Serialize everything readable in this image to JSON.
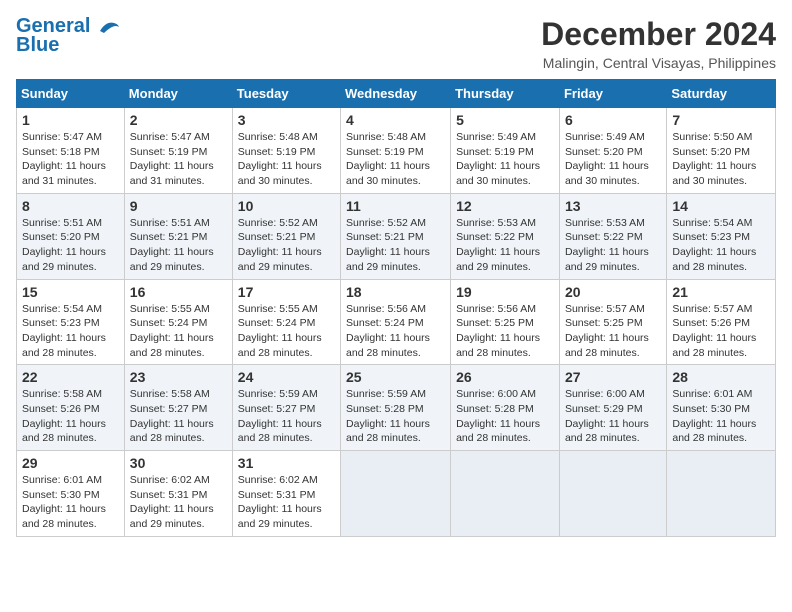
{
  "header": {
    "logo_line1": "General",
    "logo_line2": "Blue",
    "month_title": "December 2024",
    "location": "Malingin, Central Visayas, Philippines"
  },
  "weekdays": [
    "Sunday",
    "Monday",
    "Tuesday",
    "Wednesday",
    "Thursday",
    "Friday",
    "Saturday"
  ],
  "weeks": [
    [
      {
        "day": "1",
        "sunrise": "Sunrise: 5:47 AM",
        "sunset": "Sunset: 5:18 PM",
        "daylight": "Daylight: 11 hours and 31 minutes."
      },
      {
        "day": "2",
        "sunrise": "Sunrise: 5:47 AM",
        "sunset": "Sunset: 5:19 PM",
        "daylight": "Daylight: 11 hours and 31 minutes."
      },
      {
        "day": "3",
        "sunrise": "Sunrise: 5:48 AM",
        "sunset": "Sunset: 5:19 PM",
        "daylight": "Daylight: 11 hours and 30 minutes."
      },
      {
        "day": "4",
        "sunrise": "Sunrise: 5:48 AM",
        "sunset": "Sunset: 5:19 PM",
        "daylight": "Daylight: 11 hours and 30 minutes."
      },
      {
        "day": "5",
        "sunrise": "Sunrise: 5:49 AM",
        "sunset": "Sunset: 5:19 PM",
        "daylight": "Daylight: 11 hours and 30 minutes."
      },
      {
        "day": "6",
        "sunrise": "Sunrise: 5:49 AM",
        "sunset": "Sunset: 5:20 PM",
        "daylight": "Daylight: 11 hours and 30 minutes."
      },
      {
        "day": "7",
        "sunrise": "Sunrise: 5:50 AM",
        "sunset": "Sunset: 5:20 PM",
        "daylight": "Daylight: 11 hours and 30 minutes."
      }
    ],
    [
      {
        "day": "8",
        "sunrise": "Sunrise: 5:51 AM",
        "sunset": "Sunset: 5:20 PM",
        "daylight": "Daylight: 11 hours and 29 minutes."
      },
      {
        "day": "9",
        "sunrise": "Sunrise: 5:51 AM",
        "sunset": "Sunset: 5:21 PM",
        "daylight": "Daylight: 11 hours and 29 minutes."
      },
      {
        "day": "10",
        "sunrise": "Sunrise: 5:52 AM",
        "sunset": "Sunset: 5:21 PM",
        "daylight": "Daylight: 11 hours and 29 minutes."
      },
      {
        "day": "11",
        "sunrise": "Sunrise: 5:52 AM",
        "sunset": "Sunset: 5:21 PM",
        "daylight": "Daylight: 11 hours and 29 minutes."
      },
      {
        "day": "12",
        "sunrise": "Sunrise: 5:53 AM",
        "sunset": "Sunset: 5:22 PM",
        "daylight": "Daylight: 11 hours and 29 minutes."
      },
      {
        "day": "13",
        "sunrise": "Sunrise: 5:53 AM",
        "sunset": "Sunset: 5:22 PM",
        "daylight": "Daylight: 11 hours and 29 minutes."
      },
      {
        "day": "14",
        "sunrise": "Sunrise: 5:54 AM",
        "sunset": "Sunset: 5:23 PM",
        "daylight": "Daylight: 11 hours and 28 minutes."
      }
    ],
    [
      {
        "day": "15",
        "sunrise": "Sunrise: 5:54 AM",
        "sunset": "Sunset: 5:23 PM",
        "daylight": "Daylight: 11 hours and 28 minutes."
      },
      {
        "day": "16",
        "sunrise": "Sunrise: 5:55 AM",
        "sunset": "Sunset: 5:24 PM",
        "daylight": "Daylight: 11 hours and 28 minutes."
      },
      {
        "day": "17",
        "sunrise": "Sunrise: 5:55 AM",
        "sunset": "Sunset: 5:24 PM",
        "daylight": "Daylight: 11 hours and 28 minutes."
      },
      {
        "day": "18",
        "sunrise": "Sunrise: 5:56 AM",
        "sunset": "Sunset: 5:24 PM",
        "daylight": "Daylight: 11 hours and 28 minutes."
      },
      {
        "day": "19",
        "sunrise": "Sunrise: 5:56 AM",
        "sunset": "Sunset: 5:25 PM",
        "daylight": "Daylight: 11 hours and 28 minutes."
      },
      {
        "day": "20",
        "sunrise": "Sunrise: 5:57 AM",
        "sunset": "Sunset: 5:25 PM",
        "daylight": "Daylight: 11 hours and 28 minutes."
      },
      {
        "day": "21",
        "sunrise": "Sunrise: 5:57 AM",
        "sunset": "Sunset: 5:26 PM",
        "daylight": "Daylight: 11 hours and 28 minutes."
      }
    ],
    [
      {
        "day": "22",
        "sunrise": "Sunrise: 5:58 AM",
        "sunset": "Sunset: 5:26 PM",
        "daylight": "Daylight: 11 hours and 28 minutes."
      },
      {
        "day": "23",
        "sunrise": "Sunrise: 5:58 AM",
        "sunset": "Sunset: 5:27 PM",
        "daylight": "Daylight: 11 hours and 28 minutes."
      },
      {
        "day": "24",
        "sunrise": "Sunrise: 5:59 AM",
        "sunset": "Sunset: 5:27 PM",
        "daylight": "Daylight: 11 hours and 28 minutes."
      },
      {
        "day": "25",
        "sunrise": "Sunrise: 5:59 AM",
        "sunset": "Sunset: 5:28 PM",
        "daylight": "Daylight: 11 hours and 28 minutes."
      },
      {
        "day": "26",
        "sunrise": "Sunrise: 6:00 AM",
        "sunset": "Sunset: 5:28 PM",
        "daylight": "Daylight: 11 hours and 28 minutes."
      },
      {
        "day": "27",
        "sunrise": "Sunrise: 6:00 AM",
        "sunset": "Sunset: 5:29 PM",
        "daylight": "Daylight: 11 hours and 28 minutes."
      },
      {
        "day": "28",
        "sunrise": "Sunrise: 6:01 AM",
        "sunset": "Sunset: 5:30 PM",
        "daylight": "Daylight: 11 hours and 28 minutes."
      }
    ],
    [
      {
        "day": "29",
        "sunrise": "Sunrise: 6:01 AM",
        "sunset": "Sunset: 5:30 PM",
        "daylight": "Daylight: 11 hours and 28 minutes."
      },
      {
        "day": "30",
        "sunrise": "Sunrise: 6:02 AM",
        "sunset": "Sunset: 5:31 PM",
        "daylight": "Daylight: 11 hours and 29 minutes."
      },
      {
        "day": "31",
        "sunrise": "Sunrise: 6:02 AM",
        "sunset": "Sunset: 5:31 PM",
        "daylight": "Daylight: 11 hours and 29 minutes."
      },
      null,
      null,
      null,
      null
    ]
  ]
}
